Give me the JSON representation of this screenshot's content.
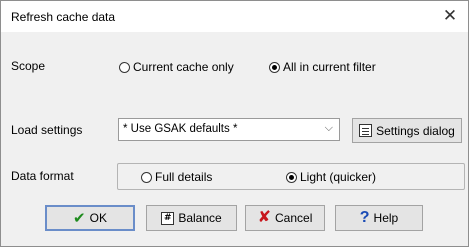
{
  "window": {
    "title": "Refresh cache data",
    "close_glyph": "✕"
  },
  "scope": {
    "label": "Scope",
    "options": [
      {
        "label": "Current cache only",
        "selected": false
      },
      {
        "label": "All in current filter",
        "selected": true
      }
    ]
  },
  "load_settings": {
    "label": "Load settings",
    "selected_value": "* Use GSAK defaults *",
    "settings_button": "Settings dialog",
    "settings_icon": "settings-icon"
  },
  "data_format": {
    "label": "Data format",
    "options": [
      {
        "label": "Full details",
        "selected": false
      },
      {
        "label": "Light (quicker)",
        "selected": true
      }
    ]
  },
  "buttons": {
    "ok": "OK",
    "balance": "Balance",
    "cancel": "Cancel",
    "help": "Help"
  },
  "colors": {
    "ok_icon": "#1e8b1e",
    "cancel_icon": "#c8161d",
    "help_icon": "#1a4bb5",
    "default_border": "#6a8dc9"
  }
}
